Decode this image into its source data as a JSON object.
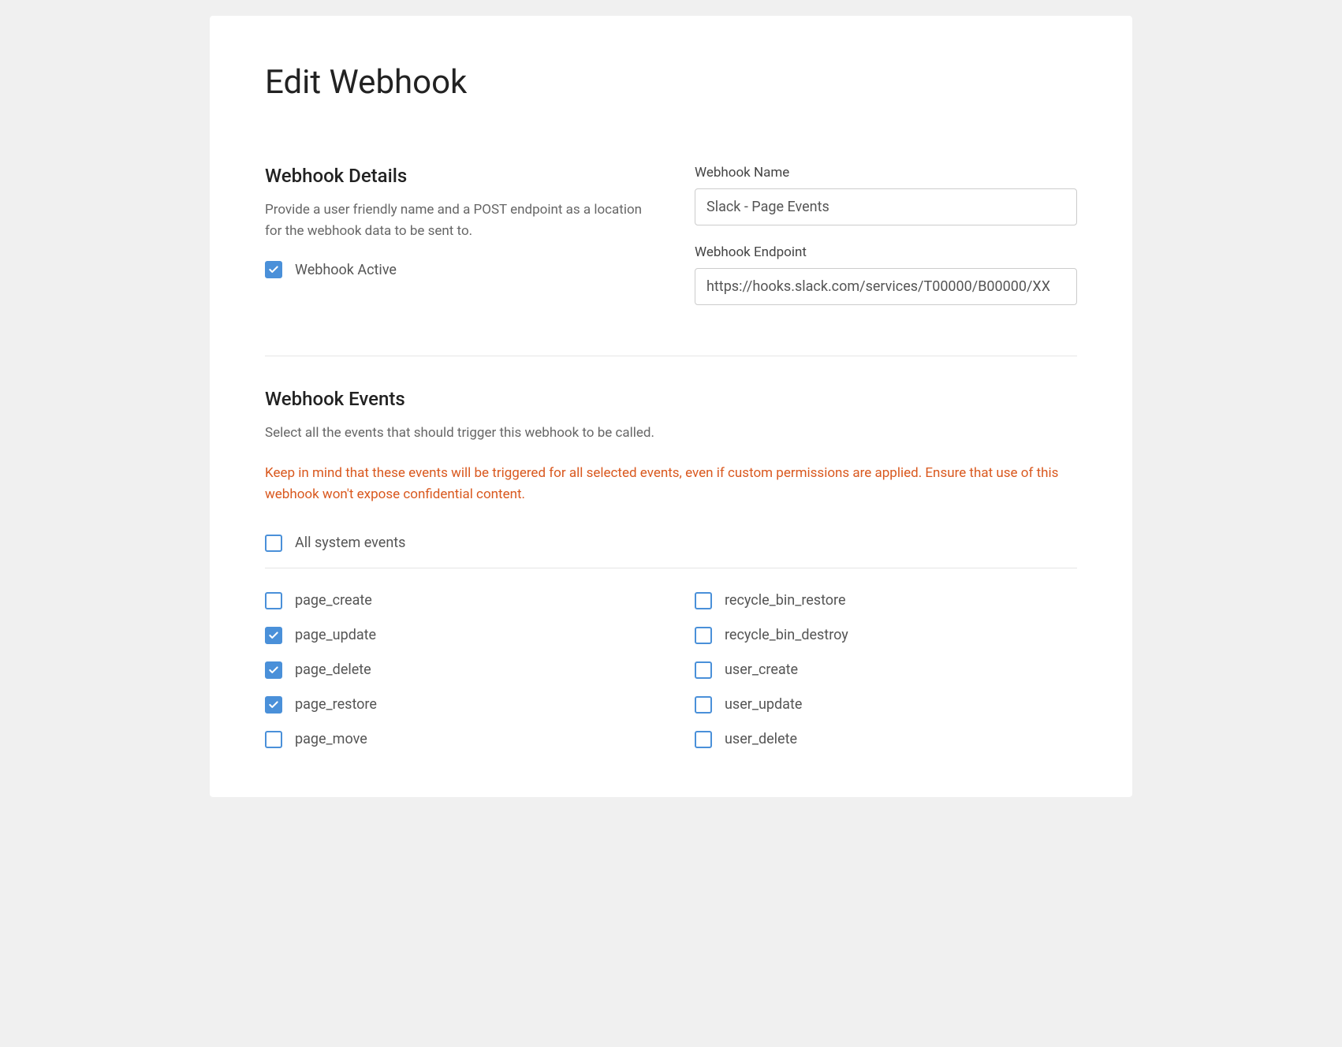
{
  "page_title": "Edit Webhook",
  "details": {
    "heading": "Webhook Details",
    "description": "Provide a user friendly name and a POST endpoint as a location for the webhook data to be sent to.",
    "active_label": "Webhook Active",
    "active_checked": true,
    "name_label": "Webhook Name",
    "name_value": "Slack - Page Events",
    "endpoint_label": "Webhook Endpoint",
    "endpoint_value": "https://hooks.slack.com/services/T00000/B00000/XX"
  },
  "events": {
    "heading": "Webhook Events",
    "description": "Select all the events that should trigger this webhook to be called.",
    "warning": "Keep in mind that these events will be triggered for all selected events, even if custom permissions are applied. Ensure that use of this webhook won't expose confidential content.",
    "all_label": "All system events",
    "all_checked": false,
    "left_column": [
      {
        "label": "page_create",
        "checked": false
      },
      {
        "label": "page_update",
        "checked": true
      },
      {
        "label": "page_delete",
        "checked": true
      },
      {
        "label": "page_restore",
        "checked": true
      },
      {
        "label": "page_move",
        "checked": false
      }
    ],
    "right_column": [
      {
        "label": "recycle_bin_restore",
        "checked": false
      },
      {
        "label": "recycle_bin_destroy",
        "checked": false
      },
      {
        "label": "user_create",
        "checked": false
      },
      {
        "label": "user_update",
        "checked": false
      },
      {
        "label": "user_delete",
        "checked": false
      }
    ]
  }
}
